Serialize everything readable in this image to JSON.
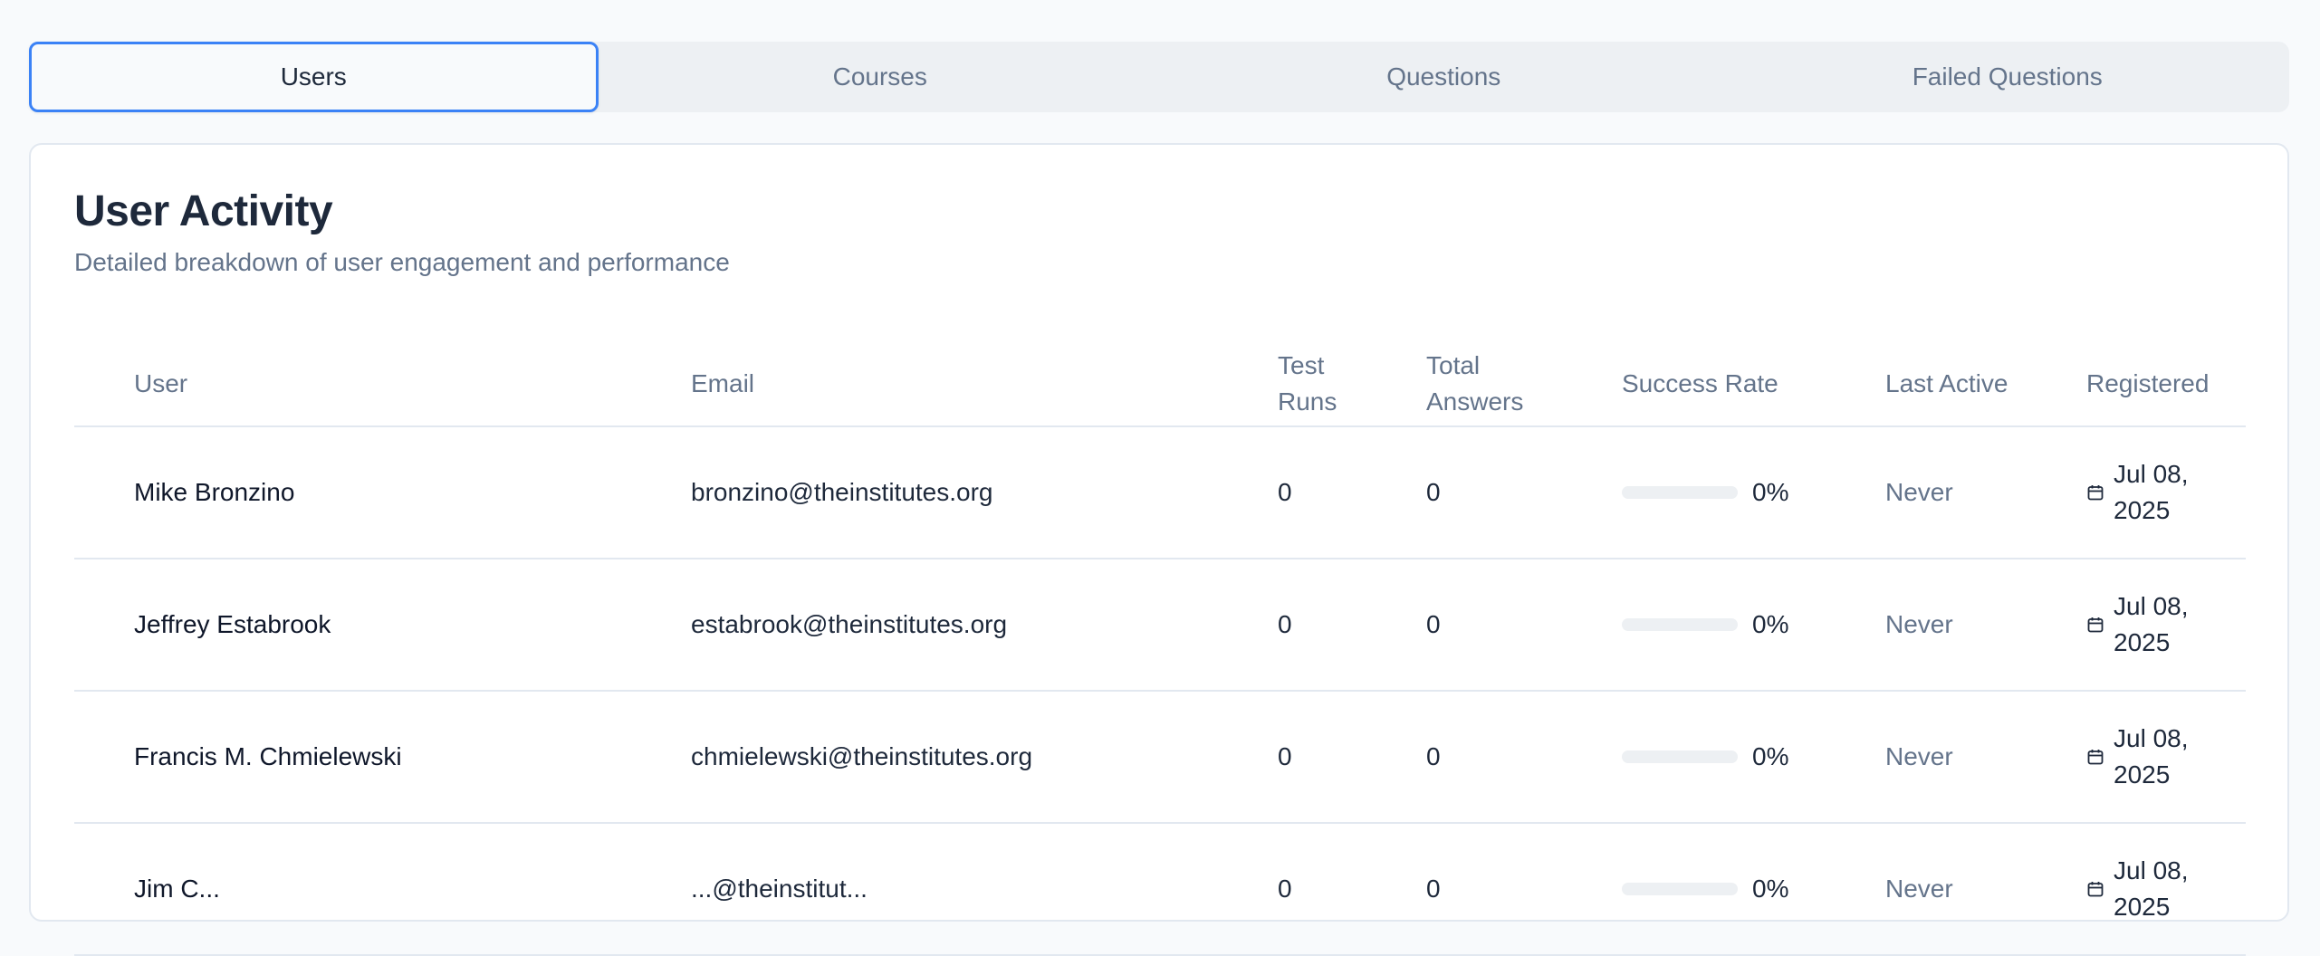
{
  "tabs": [
    {
      "label": "Users",
      "active": true
    },
    {
      "label": "Courses",
      "active": false
    },
    {
      "label": "Questions",
      "active": false
    },
    {
      "label": "Failed Questions",
      "active": false
    }
  ],
  "card": {
    "title": "User Activity",
    "subtitle": "Detailed breakdown of user engagement and performance"
  },
  "table": {
    "headers": {
      "user": "User",
      "email": "Email",
      "test_runs": "Test Runs",
      "total_answers": "Total Answers",
      "success_rate": "Success Rate",
      "last_active": "Last Active",
      "registered": "Registered"
    },
    "rows": [
      {
        "name": "Mike Bronzino",
        "email": "bronzino@theinstitutes.org",
        "test_runs": "0",
        "total_answers": "0",
        "success_rate": "0%",
        "success_fraction": 0,
        "last_active": "Never",
        "registered": "Jul 08, 2025"
      },
      {
        "name": "Jeffrey Estabrook",
        "email": "estabrook@theinstitutes.org",
        "test_runs": "0",
        "total_answers": "0",
        "success_rate": "0%",
        "success_fraction": 0,
        "last_active": "Never",
        "registered": "Jul 08, 2025"
      },
      {
        "name": "Francis M. Chmielewski",
        "email": "chmielewski@theinstitutes.org",
        "test_runs": "0",
        "total_answers": "0",
        "success_rate": "0%",
        "success_fraction": 0,
        "last_active": "Never",
        "registered": "Jul 08, 2025"
      },
      {
        "name": "Jim C...",
        "email": "...@theinstitut...",
        "test_runs": "0",
        "total_answers": "0",
        "success_rate": "0%",
        "success_fraction": 0,
        "last_active": "Never",
        "registered": "Jul 08, 2025"
      }
    ]
  },
  "colors": {
    "accent": "#3b82f6",
    "muted_text": "#64748b",
    "border": "#e2e8f0"
  },
  "icons": {
    "registered": "calendar-icon"
  }
}
